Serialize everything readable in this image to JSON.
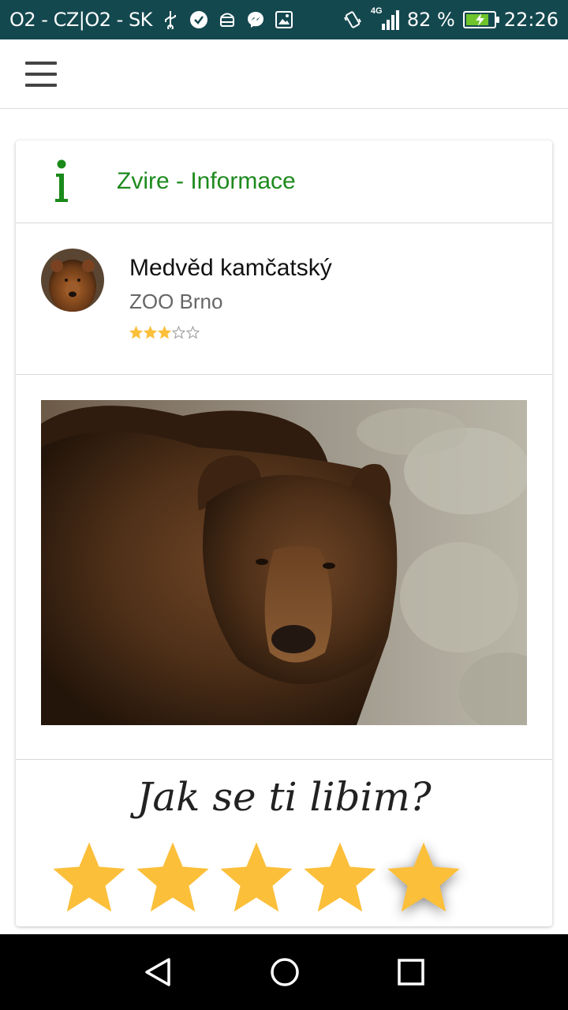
{
  "status_bar": {
    "carrier": "O2 - CZ|O2 - SK",
    "network": "4G",
    "battery_percent": "82 %",
    "battery_level": 0.82,
    "time": "22:26",
    "icons": [
      "usb-icon",
      "check-circle-icon",
      "android-icon",
      "messenger-icon",
      "image-icon",
      "vibrate-icon",
      "signal-icon",
      "battery-charging-icon"
    ]
  },
  "app_bar": {
    "menu_icon": "hamburger-menu-icon"
  },
  "card": {
    "header_icon": "info-icon",
    "title": "Zvire - Informace"
  },
  "animal": {
    "name": "Medvěd kamčatský",
    "zoo": "ZOO Brno",
    "rating": 3,
    "rating_max": 5,
    "avatar": "bear-avatar",
    "photo": "brown-bear-photo"
  },
  "rating_prompt": {
    "question": "Jak se ti libim?",
    "stars": 5,
    "selected": 5,
    "star_color": "#fbbf3a"
  },
  "colors": {
    "status_bar": "#14484f",
    "title_green": "#1e8a1e",
    "star_gold": "#fbbf3a"
  },
  "nav_bar": {
    "buttons": [
      "back-icon",
      "home-icon",
      "recents-icon"
    ]
  }
}
